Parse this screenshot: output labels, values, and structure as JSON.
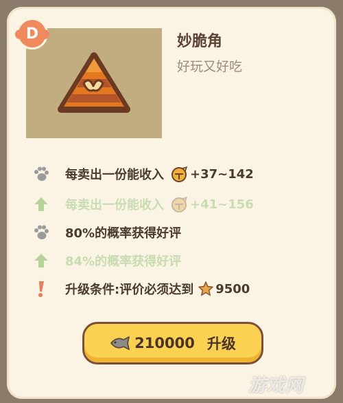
{
  "item": {
    "grade": "D",
    "name": "妙脆角",
    "description": "好玩又好吃"
  },
  "stats": [
    {
      "icon": "paw-icon",
      "text": "每卖出一份能收入",
      "extra_icon": "coin-bell-icon",
      "value": "+37~142",
      "preview": false
    },
    {
      "icon": "upgrade-arrow-icon",
      "text": "每卖出一份能收入",
      "extra_icon": "coin-bell-icon",
      "value": "+41~156",
      "preview": true
    },
    {
      "icon": "paw-icon",
      "text": "80%的概率获得好评",
      "preview": false
    },
    {
      "icon": "upgrade-arrow-icon",
      "text": "84%的概率获得好评",
      "preview": true
    },
    {
      "icon": "exclamation-icon",
      "text": "升级条件:评价必须达到",
      "extra_icon": "star-icon",
      "value": "9500",
      "preview": false
    }
  ],
  "upgrade_button": {
    "cost": "210000",
    "label": "升级",
    "icon": "fish-icon"
  },
  "watermark": "游戏网",
  "colors": {
    "card_bg": "#fbf4e4",
    "button_bg": "#fbd152",
    "button_border": "#7b4f39",
    "badge": "#f08a5d",
    "preview_green": "#c7dcb0"
  }
}
